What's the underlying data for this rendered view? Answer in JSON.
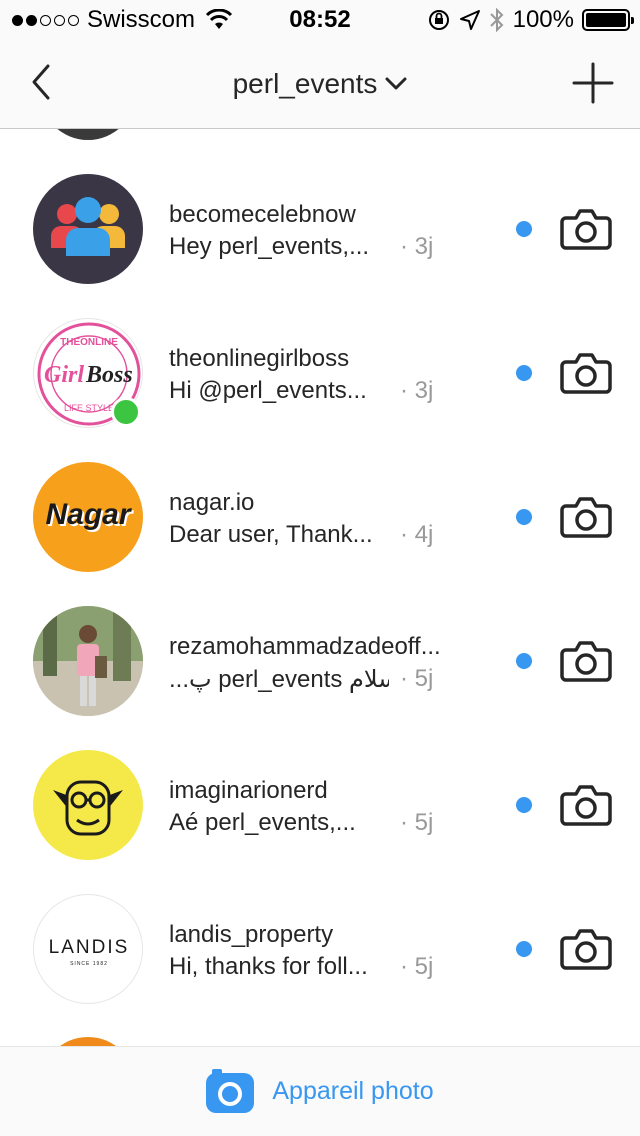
{
  "status_bar": {
    "carrier": "Swisscom",
    "time": "08:52",
    "battery": "100%",
    "battery_level": 1.0,
    "signal_bars_filled": 2,
    "signal_bars_total": 5
  },
  "nav": {
    "title": "perl_events",
    "back_icon": "chevron-left-icon",
    "add_icon": "plus-icon",
    "dropdown_icon": "chevron-down-icon"
  },
  "conversations": [
    {
      "username": "becomecelebnow",
      "preview": "Hey perl_events,...",
      "age": "· 3j",
      "unread": true,
      "online": false
    },
    {
      "username": "theonlinegirlboss",
      "preview": "Hi @perl_events...",
      "age": "· 3j",
      "unread": true,
      "online": true,
      "avatar_text": "GirlBoss",
      "avatar_ring_text": "THEONLINE · LIFE STYLE"
    },
    {
      "username": "nagar.io",
      "preview": "Dear user, Thank...",
      "age": "· 4j",
      "unread": true,
      "online": false,
      "avatar_text": "Nagar"
    },
    {
      "username": "rezamohammadzadeoff...",
      "preview": "...پ perl_events سلام",
      "age": "· 5j",
      "unread": true,
      "online": false
    },
    {
      "username": "imaginarionerd",
      "preview": "Aé perl_events,...",
      "age": "· 5j",
      "unread": true,
      "online": false
    },
    {
      "username": "landis_property",
      "preview": "Hi, thanks for foll...",
      "age": "· 5j",
      "unread": true,
      "online": false,
      "avatar_text": "LANDIS",
      "avatar_subtext": "SINCE 1982"
    }
  ],
  "bottom_bar": {
    "label": "Appareil photo",
    "icon": "camera-icon"
  },
  "colors": {
    "accent": "#3897f0",
    "online": "#3bc540",
    "text": "#262626",
    "muted": "#999999",
    "bar_bg": "#fafafa"
  }
}
